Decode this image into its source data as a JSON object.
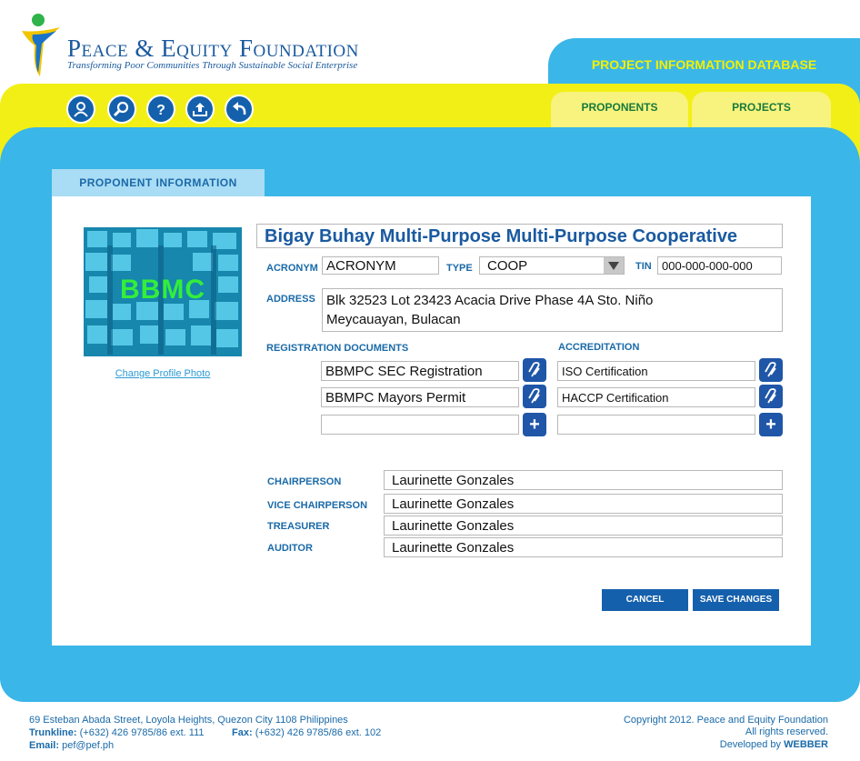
{
  "header": {
    "org_name": "Peace & Equity Foundation",
    "tagline": "Transforming Poor Communities Through Sustainable Social Enterprise",
    "database_title": "PROJECT INFORMATION DATABASE"
  },
  "toolbar": {
    "icons": [
      "user-icon",
      "search-icon",
      "help-icon",
      "upload-icon",
      "back-icon"
    ]
  },
  "nav_tabs": [
    {
      "label": "PROPONENTS"
    },
    {
      "label": "PROJECTS"
    }
  ],
  "panel": {
    "tab_label": "PROPONENT INFORMATION",
    "photo_text": "BBMC",
    "change_photo_label": "Change Profile Photo",
    "name": "Bigay Buhay Multi-Purpose Multi-Purpose Cooperative",
    "acronym_label": "ACRONYM",
    "acronym_value": "ACRONYM",
    "type_label": "TYPE",
    "type_value": "COOP",
    "tin_label": "TIN",
    "tin_value": "000-000-000-000",
    "address_label": "ADDRESS",
    "address_line1": "Blk 32523 Lot 23423 Acacia Drive Phase 4A Sto. Niño",
    "address_line2": "Meycauayan, Bulacan",
    "registration_label": "REGISTRATION DOCUMENTS",
    "registration_docs": [
      "BBMPC SEC Registration",
      "BBMPC Mayors Permit",
      ""
    ],
    "accreditation_label": "ACCREDITATION",
    "accreditation_docs": [
      "ISO Certification",
      "HACCP Certification",
      ""
    ],
    "officers": [
      {
        "role": "CHAIRPERSON",
        "name": "Laurinette Gonzales"
      },
      {
        "role": "VICE CHAIRPERSON",
        "name": "Laurinette Gonzales"
      },
      {
        "role": "TREASURER",
        "name": "Laurinette Gonzales"
      },
      {
        "role": "AUDITOR",
        "name": "Laurinette Gonzales"
      }
    ],
    "cancel_label": "CANCEL",
    "save_label": "SAVE CHANGES"
  },
  "footer": {
    "address": "69 Esteban Abada Street, Loyola Heights, Quezon City 1108 Philippines",
    "trunkline_label": "Trunkline:",
    "trunkline_value": "(+632) 426 9785/86 ext. 111",
    "fax_label": "Fax:",
    "fax_value": "(+632) 426 9785/86 ext. 102",
    "email_label": "Email:",
    "email_value": "pef@pef.ph",
    "copyright": "Copyright 2012. Peace and Equity Foundation",
    "rights": "All rights reserved.",
    "developed_by_label": "Developed by",
    "developer": "WEBBER"
  },
  "colors": {
    "brand_blue": "#1560ac",
    "sky_blue": "#3ab6e8",
    "yellow": "#f2ef16",
    "tab_green": "#1a7a3c"
  }
}
